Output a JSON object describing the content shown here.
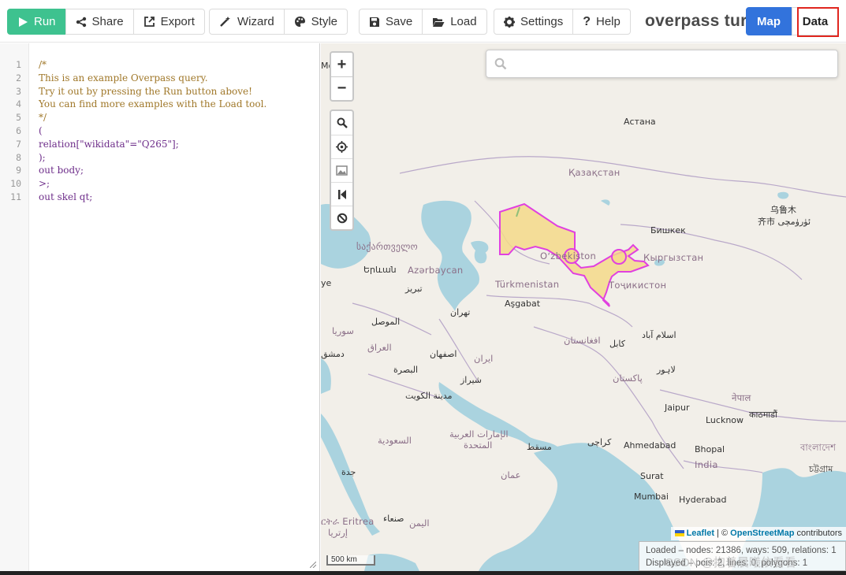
{
  "toolbar": {
    "run": "Run",
    "share": "Share",
    "export": "Export",
    "wizard": "Wizard",
    "style": "Style",
    "save": "Save",
    "load": "Load",
    "settings": "Settings",
    "help": "Help"
  },
  "app_title": "overpass turbo",
  "view_tabs": {
    "map": "Map",
    "data": "Data"
  },
  "editor": {
    "line_numbers": [
      "1",
      "2",
      "3",
      "4",
      "5",
      "6",
      "7",
      "8",
      "9",
      "10",
      "11"
    ],
    "lines": [
      {
        "text": "/*",
        "kind": "comment"
      },
      {
        "text": "This is an example Overpass query.",
        "kind": "comment"
      },
      {
        "text": "Try it out by pressing the Run button above!",
        "kind": "comment"
      },
      {
        "text": "You can find more examples with the Load tool.",
        "kind": "comment"
      },
      {
        "text": "*/",
        "kind": "comment"
      },
      {
        "text": "(",
        "kind": "code"
      },
      {
        "text": "relation[\"wikidata\"=\"Q265\"];",
        "kind": "code"
      },
      {
        "text": ");",
        "kind": "code"
      },
      {
        "text": "out body;",
        "kind": "code"
      },
      {
        "text": ">;",
        "kind": "code"
      },
      {
        "text": "out skel qt;",
        "kind": "code"
      }
    ]
  },
  "map": {
    "zoom_in": "+",
    "zoom_out": "−",
    "search_placeholder": "",
    "labels": {
      "astana": "Астана",
      "kazakhstan": "Қазақстан",
      "urumqi": "乌鲁木",
      "urumqi2": "齐市 ئۈرۈمچی",
      "bishkek": "Бишкек",
      "uzbekistan": "Oʻzbekiston",
      "kyrgyzstan": "Кыргызстан",
      "tajikistan": "Тоҷикистон",
      "turkmenistan": "Türkmenistan",
      "ashgabat": "Aşgabat",
      "azerbaycan": "Azərbaycan",
      "yerevan": "Երևան",
      "georgia": "საქართველო",
      "moscow": "Моска",
      "tabriz": "تبریز",
      "tehran": "تهران",
      "mosul": "الموصل",
      "syria": "سوريا",
      "iraq": "العراق",
      "damascus": "دمشق",
      "isfahan": "اصفهان",
      "iran": "ایران",
      "basra": "البصرة",
      "shiraz": "شیراز",
      "kuwait": "مدينة الكويت",
      "afghanistan": "افغانستان",
      "kabul": "کابل",
      "islamabad": "اسلام آباد",
      "lahore": "لاہور",
      "pakistan": "پاکستان",
      "nepal": "नेपाल",
      "kathmandu": "काठमाडौं",
      "jaipur": "Jaipur",
      "lucknow": "Lucknow",
      "saudi": "السعودية",
      "uae": "الإمارات العربية",
      "uae2": "المتحدة",
      "muscat": "مسقط",
      "karachi": "کراچی",
      "ahmedabad": "Ahmedabad",
      "bhopal": "Bhopal",
      "india": "India",
      "bangladesh": "বাংলাদেশ",
      "chittagong": "চট্টগ্রাম",
      "oman": "عمان",
      "jeddah": "جدة",
      "surat": "Surat",
      "mumbai": "Mumbai",
      "hyderabad": "Hyderabad",
      "eritrea": "ርትራ Eritrea",
      "eritrea2": "إرتريا",
      "sanaa": "صنعاء",
      "yemen": "اليمن",
      "ye": "ye"
    },
    "attribution_leaflet": "Leaflet",
    "attribution_sep": " | © ",
    "attribution_osm": "OpenStreetMap",
    "attribution_rest": " contributors",
    "status_line1": "Loaded – nodes: 21386, ways: 509, relations: 1",
    "status_line2": "Displayed – pois: 2, lines: 0, polygons: 1",
    "scale": "500 km"
  },
  "watermark": "CSDN @抱着晨曦依看看",
  "colors": {
    "run": "#3ec28f",
    "map_tab": "#3273dc",
    "highlight": "#e0261f",
    "polygon_fill": "#f5d98a",
    "polygon_stroke": "#e040e0",
    "water": "#aad3df",
    "land": "#f2efe9"
  }
}
